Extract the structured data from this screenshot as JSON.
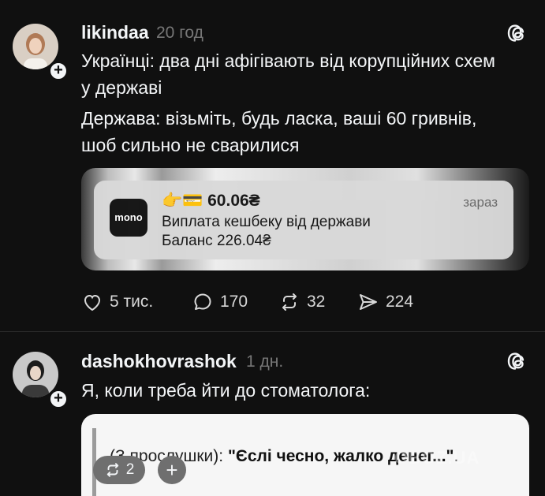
{
  "post1": {
    "username": "likindaa",
    "time": "20 год",
    "lines": [
      "Українці: два дні афігівають від корупційних схем",
      "у державі",
      "Держава: візьміть, будь ласка, ваші 60 гривнів,",
      "шоб сильно не сварилися"
    ],
    "notification": {
      "app_logo": "mono",
      "amount": "👉💳 60.06₴",
      "title": "Виплата кешбеку від держави",
      "balance": "Баланс 226.04₴",
      "time": "зараз"
    },
    "actions": {
      "likes": "5 тис.",
      "replies": "170",
      "reposts": "32",
      "shares": "224"
    }
  },
  "post2": {
    "username": "dashokhovrashok",
    "time": "1 дн.",
    "lines": [
      "Я, коли треба йти до стоматолога:"
    ],
    "quote": {
      "prefix": "(З прослушки): ",
      "bold": "\"Єслі чесно, жалко денег...\"",
      "suffix": "."
    }
  },
  "floating": {
    "repost_count": "2",
    "plus": "+"
  },
  "watermark": "OBOZ.UA",
  "icons": {
    "threads": "threads-icon",
    "like": "heart-icon",
    "reply": "comment-icon",
    "repost": "repost-icon",
    "share": "send-icon"
  }
}
